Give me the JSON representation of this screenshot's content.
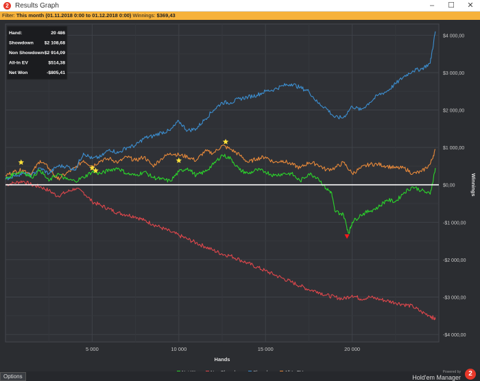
{
  "window": {
    "title": "Results Graph",
    "icon_glyph": "2",
    "minimize_glyph": "–",
    "maximize_glyph": "☐",
    "close_glyph": "✕"
  },
  "filter": {
    "label": "Filter:",
    "range": "This month (01.11.2018 0:00 to 01.12.2018 0:00)",
    "winnings_label": "Winnings:",
    "winnings_value": "$369,43"
  },
  "stats": [
    {
      "label": "Hand:",
      "value": "20 486"
    },
    {
      "label": "Showdown",
      "value": "$2 108,68"
    },
    {
      "label": "Non Showdown",
      "value": "-$2 914,09"
    },
    {
      "label": "All-In EV",
      "value": "$514,38"
    },
    {
      "label": "Net Won",
      "value": "-$805,41"
    }
  ],
  "footer": {
    "options_label": "Options",
    "powered_by": "Powered by",
    "brand": "Hold'em Manager",
    "brand_logo_glyph": "2"
  },
  "colors": {
    "net_won": "#2bd62b",
    "non_showdown": "#e0474c",
    "showdown": "#3c8fd1",
    "all_in_ev": "#e8893a",
    "background": "#2b2d31",
    "zero_line": "#ffffff",
    "star": "#ffe23a",
    "marker_red": "#ff1a1a"
  },
  "chart_data": {
    "type": "line",
    "xlabel": "Hands",
    "ylabel": "Winnings",
    "xlim": [
      0,
      25000
    ],
    "ylim": [
      -4200,
      4300
    ],
    "x_ticks": [
      5000,
      10000,
      15000,
      20000
    ],
    "x_tick_labels": [
      "5 000",
      "10 000",
      "15 000",
      "20 000"
    ],
    "y_ticks": [
      4000,
      3000,
      2000,
      1000,
      0,
      -1000,
      -2000,
      -3000,
      -4000
    ],
    "y_tick_labels": [
      "$4 000,00",
      "$3 000,00",
      "$2 000,00",
      "$1 000,00",
      "$0,00",
      "-$1 000,00",
      "-$2 000,00",
      "-$3 000,00",
      "-$4 000,00"
    ],
    "grid": true,
    "legend_position": "bottom-center",
    "series": [
      {
        "name": "Net Won",
        "color_key": "net_won",
        "x": [
          0,
          500,
          1000,
          1500,
          2000,
          2500,
          3000,
          3500,
          4000,
          4500,
          5000,
          5500,
          6000,
          6500,
          7000,
          7500,
          8000,
          8500,
          9000,
          9500,
          10000,
          10500,
          11000,
          11500,
          12000,
          12500,
          13000,
          13500,
          14000,
          14500,
          15000,
          15500,
          16000,
          16500,
          17000,
          17500,
          18000,
          18500,
          18800,
          19000,
          19500,
          19800,
          20000,
          20500,
          21000,
          21500,
          22000,
          22500,
          23000,
          23500,
          24000,
          24500,
          24800
        ],
        "y": [
          150,
          300,
          350,
          200,
          400,
          100,
          300,
          150,
          100,
          200,
          350,
          300,
          400,
          450,
          300,
          250,
          350,
          200,
          150,
          100,
          350,
          450,
          250,
          350,
          550,
          800,
          700,
          400,
          300,
          400,
          350,
          250,
          300,
          300,
          100,
          300,
          200,
          -100,
          -200,
          -700,
          -800,
          -1300,
          -1000,
          -800,
          -700,
          -600,
          -400,
          -450,
          -200,
          -50,
          -150,
          -250,
          450
        ]
      },
      {
        "name": "Non Showdown",
        "color_key": "non_showdown",
        "x": [
          0,
          500,
          1000,
          1500,
          2000,
          2500,
          3000,
          3500,
          4000,
          4500,
          5000,
          5500,
          6000,
          6500,
          7000,
          7500,
          8000,
          8500,
          9000,
          9500,
          10000,
          10500,
          11000,
          11500,
          12000,
          12500,
          13000,
          13500,
          14000,
          14500,
          15000,
          15500,
          16000,
          16500,
          17000,
          17500,
          18000,
          18500,
          19000,
          19500,
          20000,
          20500,
          21000,
          21500,
          22000,
          22500,
          23000,
          23500,
          24000,
          24500,
          24800
        ],
        "y": [
          0,
          50,
          100,
          0,
          -50,
          -150,
          -300,
          -200,
          -100,
          -200,
          -450,
          -550,
          -650,
          -750,
          -800,
          -850,
          -950,
          -1050,
          -1150,
          -1250,
          -1350,
          -1450,
          -1550,
          -1650,
          -1750,
          -1850,
          -1900,
          -2000,
          -2100,
          -2200,
          -2300,
          -2400,
          -2500,
          -2600,
          -2700,
          -2800,
          -2850,
          -2950,
          -3000,
          -3050,
          -2950,
          -3050,
          -3000,
          -3050,
          -3100,
          -3150,
          -3200,
          -3250,
          -3400,
          -3500,
          -3600
        ]
      },
      {
        "name": "Showdown",
        "color_key": "showdown",
        "x": [
          0,
          500,
          1000,
          1500,
          2000,
          2500,
          3000,
          3500,
          4000,
          4500,
          5000,
          5500,
          6000,
          6500,
          7000,
          7500,
          8000,
          8500,
          9000,
          9500,
          10000,
          10500,
          11000,
          11500,
          12000,
          12500,
          13000,
          13500,
          14000,
          14500,
          15000,
          15500,
          16000,
          16500,
          17000,
          17500,
          18000,
          18500,
          19000,
          19500,
          20000,
          20500,
          21000,
          21500,
          22000,
          22500,
          23000,
          23500,
          24000,
          24500,
          24800
        ],
        "y": [
          150,
          250,
          300,
          250,
          450,
          300,
          500,
          500,
          400,
          850,
          700,
          750,
          950,
          850,
          1000,
          1050,
          1250,
          1300,
          1400,
          1450,
          1700,
          1450,
          1500,
          1750,
          2000,
          2200,
          2200,
          2300,
          2350,
          2400,
          2500,
          2550,
          2650,
          2700,
          2600,
          2500,
          2200,
          2050,
          1800,
          1800,
          2100,
          2000,
          2200,
          2400,
          2500,
          2700,
          2900,
          3050,
          3100,
          3250,
          4100
        ]
      },
      {
        "name": "All-In EV",
        "color_key": "all_in_ev",
        "x": [
          0,
          500,
          1000,
          1500,
          2000,
          2500,
          3000,
          3500,
          4000,
          4500,
          5000,
          5500,
          6000,
          6500,
          7000,
          7500,
          8000,
          8500,
          9000,
          9500,
          10000,
          10500,
          11000,
          11500,
          12000,
          12500,
          13000,
          13500,
          14000,
          14500,
          15000,
          15500,
          16000,
          16500,
          17000,
          17500,
          18000,
          18500,
          19000,
          19500,
          20000,
          20500,
          21000,
          21500,
          22000,
          22500,
          23000,
          23500,
          24000,
          24500,
          24800
        ],
        "y": [
          250,
          350,
          400,
          300,
          650,
          450,
          150,
          300,
          450,
          650,
          500,
          650,
          700,
          600,
          750,
          650,
          750,
          500,
          700,
          850,
          800,
          750,
          650,
          900,
          850,
          1050,
          950,
          800,
          600,
          700,
          750,
          600,
          650,
          550,
          450,
          600,
          550,
          400,
          450,
          600,
          300,
          450,
          550,
          550,
          500,
          450,
          450,
          300,
          350,
          550,
          950
        ]
      }
    ],
    "annotations": [
      {
        "type": "star",
        "x": 900,
        "y": 600
      },
      {
        "type": "star",
        "x": 5000,
        "y": 450
      },
      {
        "type": "star",
        "x": 5200,
        "y": 380
      },
      {
        "type": "star",
        "x": 10000,
        "y": 650
      },
      {
        "type": "star",
        "x": 12700,
        "y": 1150
      },
      {
        "type": "marker",
        "x": 19700,
        "y": -1380
      }
    ]
  }
}
